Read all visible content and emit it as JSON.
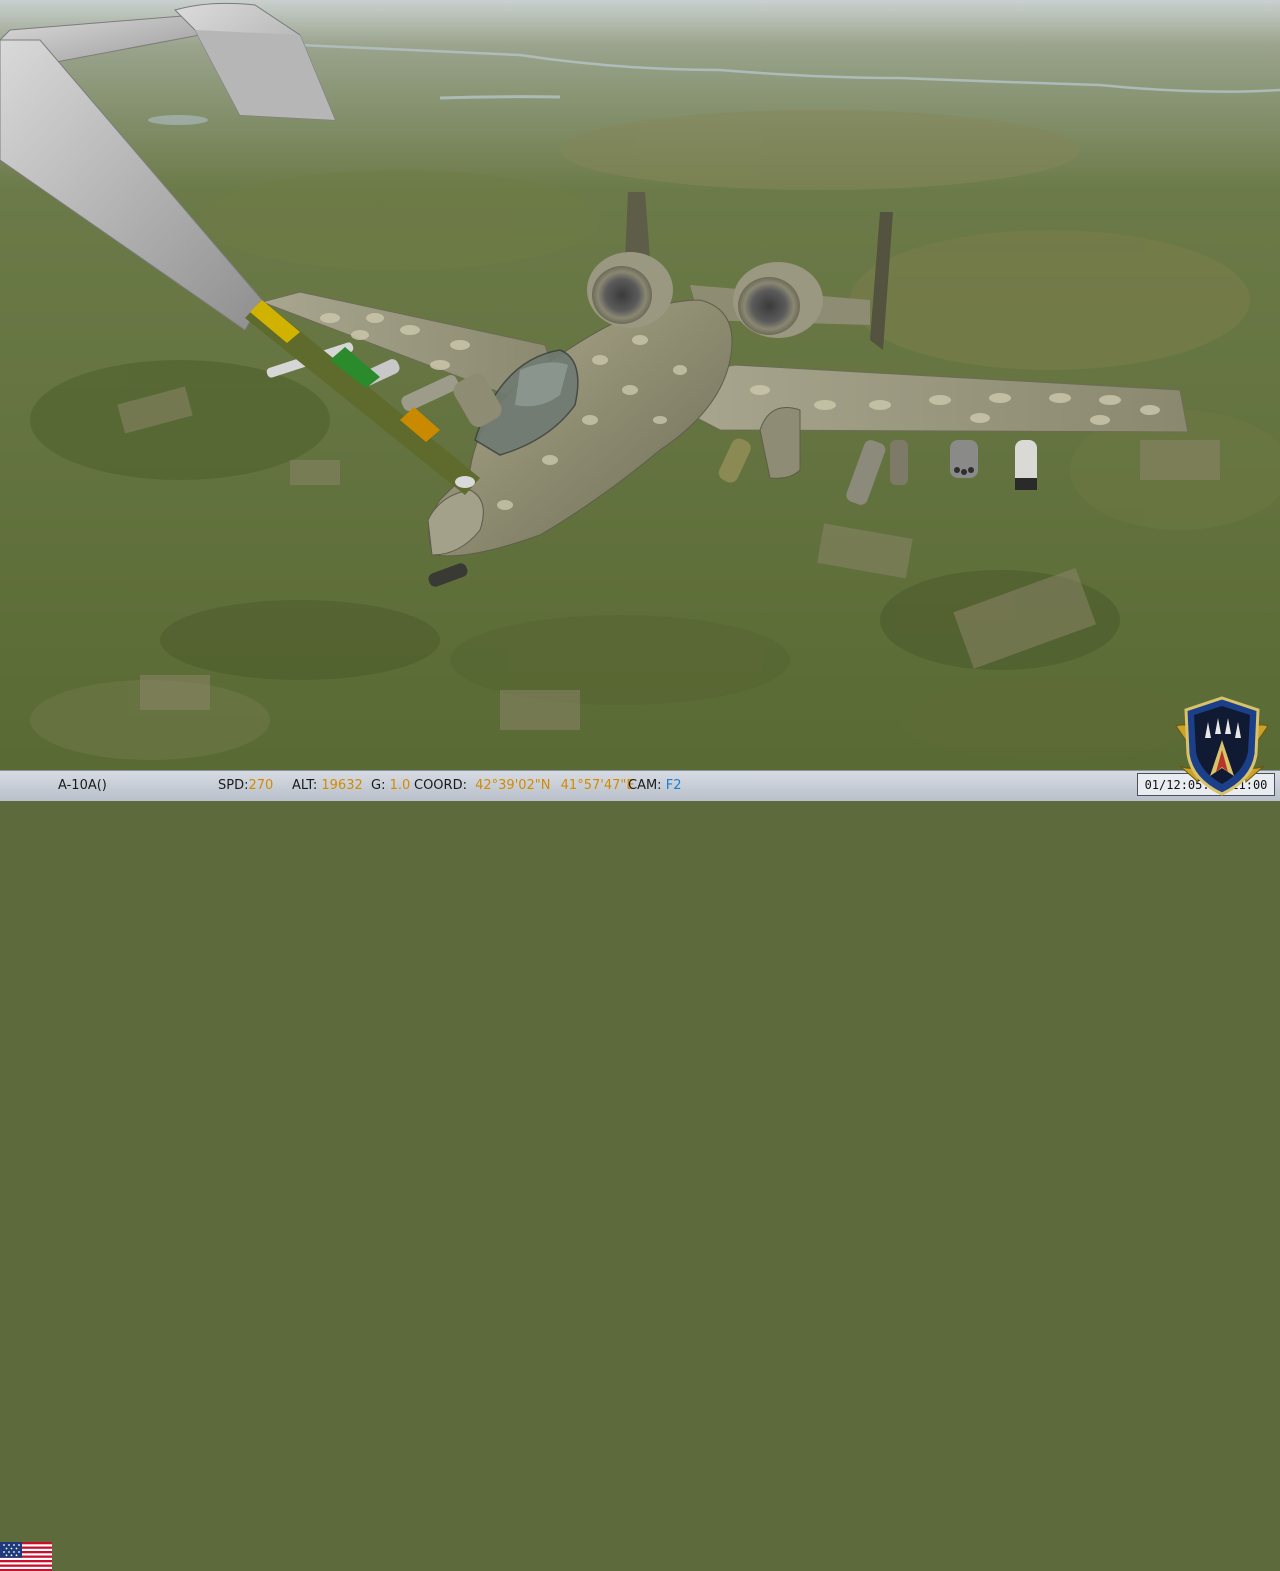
{
  "hud": {
    "aircraft_name": "A-10A()",
    "speed_label": "SPD:",
    "speed_value": "270",
    "altitude_label": "ALT:",
    "altitude_value": "19632",
    "g_label": "G:",
    "g_value": "1.0",
    "coord_label": "COORD:",
    "latitude": "42°39'02\"N",
    "longitude": "41°57'47\"E",
    "camera_label": "CAM:",
    "camera_value": "F2",
    "clock": "01/12:05:23 11:00"
  },
  "icons": {
    "nation_flag": "us-flag-icon",
    "squadron_emblem": "squadron-emblem-icon"
  },
  "colors": {
    "status_value": "#d48a00",
    "camera_value": "#1a7fd4",
    "statusbar_bg": "#c8ced7"
  }
}
